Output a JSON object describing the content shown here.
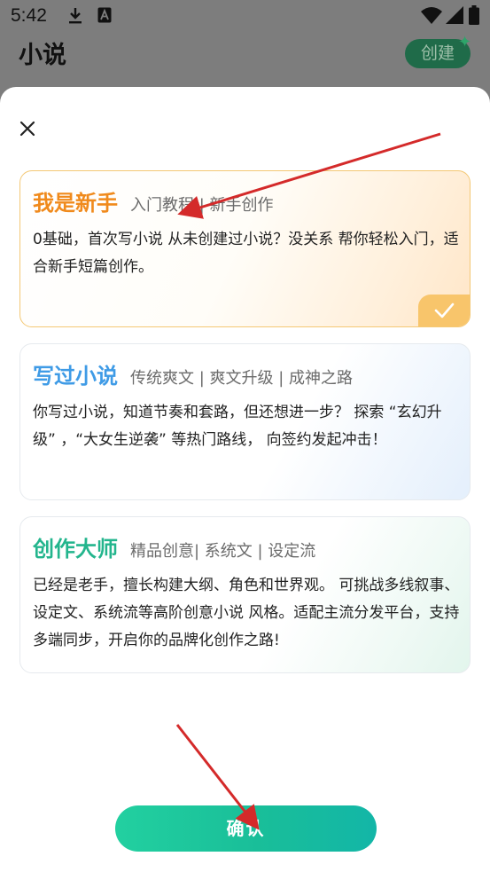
{
  "status_bar": {
    "time": "5:42",
    "icons": [
      "download-icon",
      "a-notification-icon",
      "wifi-icon",
      "signal-icon",
      "battery-icon"
    ]
  },
  "background_screen": {
    "title": "小说",
    "create_button": "创建"
  },
  "sheet": {
    "options": [
      {
        "title": "我是新手",
        "tags": "入门教程 | 新手创作",
        "description": "0基础，首次写小说 从未创建过小说？没关系 帮你轻松入门，适合新手短篇创作。",
        "selected": true,
        "accent": "#f08a1c"
      },
      {
        "title": "写过小说",
        "tags": "传统爽文 | 爽文升级 | 成神之路",
        "description": "你写过小说，知道节奏和套路，但还想进一步？ 探索 “玄幻升级” ，“大女生逆袭” 等热门路线， 向签约发起冲击！",
        "selected": false,
        "accent": "#3f9be6"
      },
      {
        "title": "创作大师",
        "tags": "精品创意| 系统文 | 设定流",
        "description": "已经是老手，擅长构建大纲、角色和世界观。 可挑战多线叙事、设定文、系统流等高阶创意小说 风格。适配主流分发平台，支持多端同步，开启你的品牌化创作之路!",
        "selected": false,
        "accent": "#23b58d"
      }
    ],
    "confirm_label": "确认"
  },
  "colors": {
    "selected_border": "#f4c874",
    "check_badge": "#f8c56b",
    "confirm_gradient_start": "#22d0a0",
    "confirm_gradient_end": "#13b6a7",
    "annotation_arrow": "#d42a2a"
  }
}
